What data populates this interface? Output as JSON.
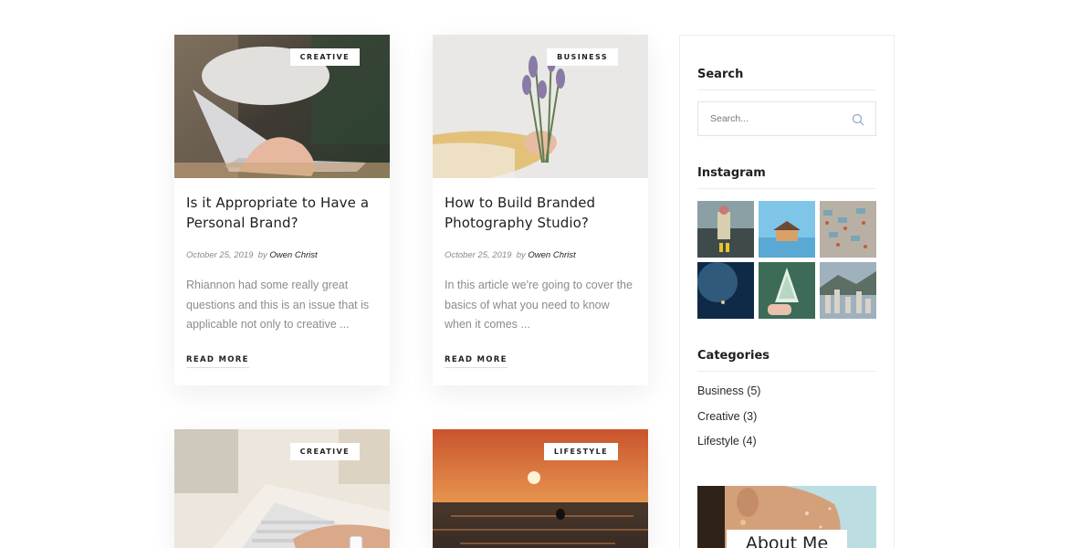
{
  "posts": [
    {
      "category": "CREATIVE",
      "title": "Is it Appropriate to Have a Personal Brand?",
      "date": "October 25, 2019",
      "by": "by",
      "author": "Owen Christ",
      "excerpt": "Rhiannon had some really great questions and this is an issue that is applicable not only to creative ...",
      "read_more": "READ MORE"
    },
    {
      "category": "BUSINESS",
      "title": "How to Build Branded Photography Studio?",
      "date": "October 25, 2019",
      "by": "by",
      "author": "Owen Christ",
      "excerpt": "In this article we're going to cover the basics of what you need to know when it comes ...",
      "read_more": "READ MORE"
    },
    {
      "category": "CREATIVE"
    },
    {
      "category": "LIFESTYLE"
    }
  ],
  "sidebar": {
    "search": {
      "title": "Search",
      "placeholder": "Search..."
    },
    "instagram": {
      "title": "Instagram"
    },
    "categories": {
      "title": "Categories",
      "items": [
        "Business (5)",
        "Creative (3)",
        "Lifestyle (4)"
      ]
    },
    "about": {
      "label": "About Me"
    }
  }
}
